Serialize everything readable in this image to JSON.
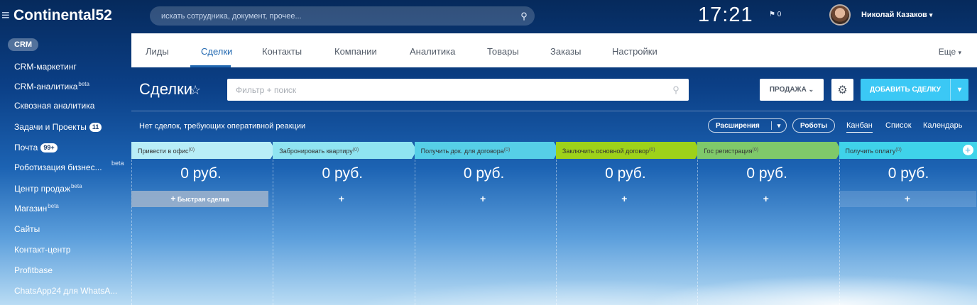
{
  "topbar": {
    "burger_icon": "≡",
    "logo": "Continental52",
    "search_placeholder": "искать сотрудника, документ, прочее...",
    "clock": "17:21",
    "flag_count": "0",
    "user_name": "Николай Казаков"
  },
  "sidebar": {
    "crm": "CRM",
    "items": [
      {
        "label": "CRM-маркетинг"
      },
      {
        "label": "CRM-аналитика",
        "sup": "beta"
      },
      {
        "label": "Сквозная аналитика"
      },
      {
        "label": "Задачи и Проекты",
        "badge": "11"
      },
      {
        "label": "Почта",
        "badge": "99+"
      },
      {
        "label": "Роботизация бизнес...",
        "beta_right": "beta"
      },
      {
        "label": "Центр продаж",
        "sup": "beta"
      },
      {
        "label": "Магазин",
        "sup": "beta"
      },
      {
        "label": "Сайты"
      },
      {
        "label": "Контакт-центр"
      },
      {
        "label": "Profitbase"
      },
      {
        "label": "ChatsApp24 для WhatsA..."
      }
    ]
  },
  "nav": {
    "tabs": [
      "Лиды",
      "Сделки",
      "Контакты",
      "Компании",
      "Аналитика",
      "Товары",
      "Заказы",
      "Настройки"
    ],
    "active_tab": "Сделки",
    "more": "Еще"
  },
  "header": {
    "title": "Сделки",
    "filter_placeholder": "Фильтр + поиск",
    "sale_button": "ПРОДАЖА",
    "add_button": "ДОБАВИТЬ СДЕЛКУ"
  },
  "toolbar": {
    "notice": "Нет сделок, требующих оперативной реакции",
    "extensions": "Расширения",
    "robots": "Роботы",
    "views": [
      "Канбан",
      "Список",
      "Календарь"
    ],
    "active_view": "Канбан"
  },
  "kanban": {
    "quick_deal": "Быстрая сделка",
    "stages": [
      {
        "name": "Привести в офис",
        "count": "(0)",
        "sum": "0 руб.",
        "color": "#b8eef7"
      },
      {
        "name": "Забронировать квартиру",
        "count": "(0)",
        "sum": "0 руб.",
        "color": "#8fe4f1"
      },
      {
        "name": "Получить док. для договора",
        "count": "(0)",
        "sum": "0 руб.",
        "color": "#56cfe7"
      },
      {
        "name": "Заключить основной договор",
        "count": "(0)",
        "sum": "0 руб.",
        "color": "#9ed21a"
      },
      {
        "name": "Гос регистрация",
        "count": "(0)",
        "sum": "0 руб.",
        "color": "#7fc96a"
      },
      {
        "name": "Получить оплату",
        "count": "(0)",
        "sum": "0 руб.",
        "color": "#3fd3ea"
      }
    ]
  }
}
